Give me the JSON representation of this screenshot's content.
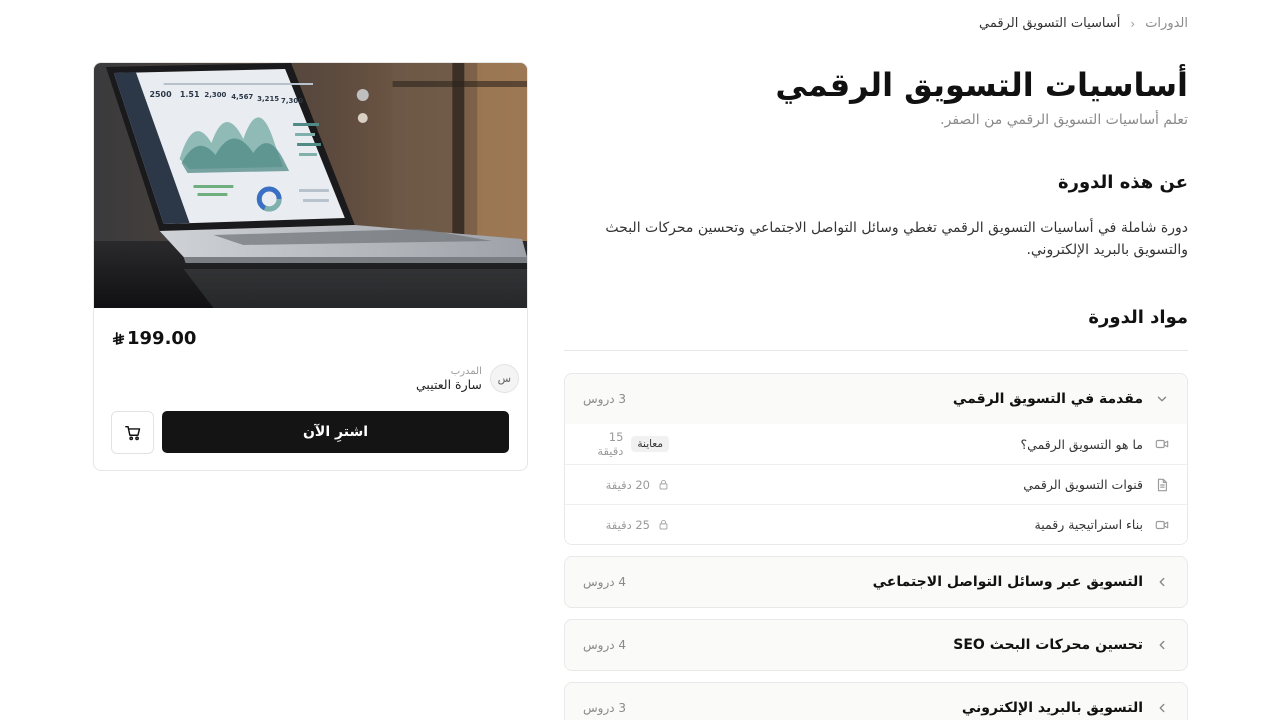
{
  "breadcrumb": {
    "root": "الدورات",
    "current": "أساسيات التسويق الرقمي"
  },
  "course": {
    "title": "أساسيات التسويق الرقمي",
    "subtitle": "تعلم أساسيات التسويق الرقمي من الصفر.",
    "about_title": "عن هذه الدورة",
    "about_text": "دورة شاملة في أساسيات التسويق الرقمي تغطي وسائل التواصل الاجتماعي وتحسين محركات البحث والتسويق بالبريد الإلكتروني.",
    "materials_title": "مواد الدورة"
  },
  "modules": [
    {
      "title": "مقدمة في التسويق الرقمي",
      "count": "3 دروس",
      "expanded": true,
      "lessons": [
        {
          "title": "ما هو التسويق الرقمي؟",
          "icon": "video-icon",
          "duration": "15 دقيقة",
          "badge": "معاينة",
          "locked": false
        },
        {
          "title": "قنوات التسويق الرقمي",
          "icon": "document-icon",
          "duration": "20 دقيقة",
          "locked": true
        },
        {
          "title": "بناء استراتيجية رقمية",
          "icon": "video-icon",
          "duration": "25 دقيقة",
          "locked": true
        }
      ]
    },
    {
      "title": "التسويق عبر وسائل التواصل الاجتماعي",
      "count": "4 دروس",
      "expanded": false
    },
    {
      "title": "تحسين محركات البحث SEO",
      "count": "4 دروس",
      "expanded": false
    },
    {
      "title": "التسويق بالبريد الإلكتروني",
      "count": "3 دروس",
      "expanded": false
    }
  ],
  "card": {
    "price": "199.00",
    "currency_icon": "riyal-icon",
    "instructor_label": "المدرب",
    "instructor_name": "سارة العتيبي",
    "avatar_initial": "س",
    "buy_label": "اشترِ الآن",
    "image_stats": [
      "2500",
      "1.51",
      "2,300",
      "4,567",
      "3,215",
      "7,300"
    ]
  },
  "colors": {
    "primary": "#141414",
    "muted": "#8a8a8a",
    "border": "#e6e6e6",
    "module_bg": "#fafaf9"
  }
}
